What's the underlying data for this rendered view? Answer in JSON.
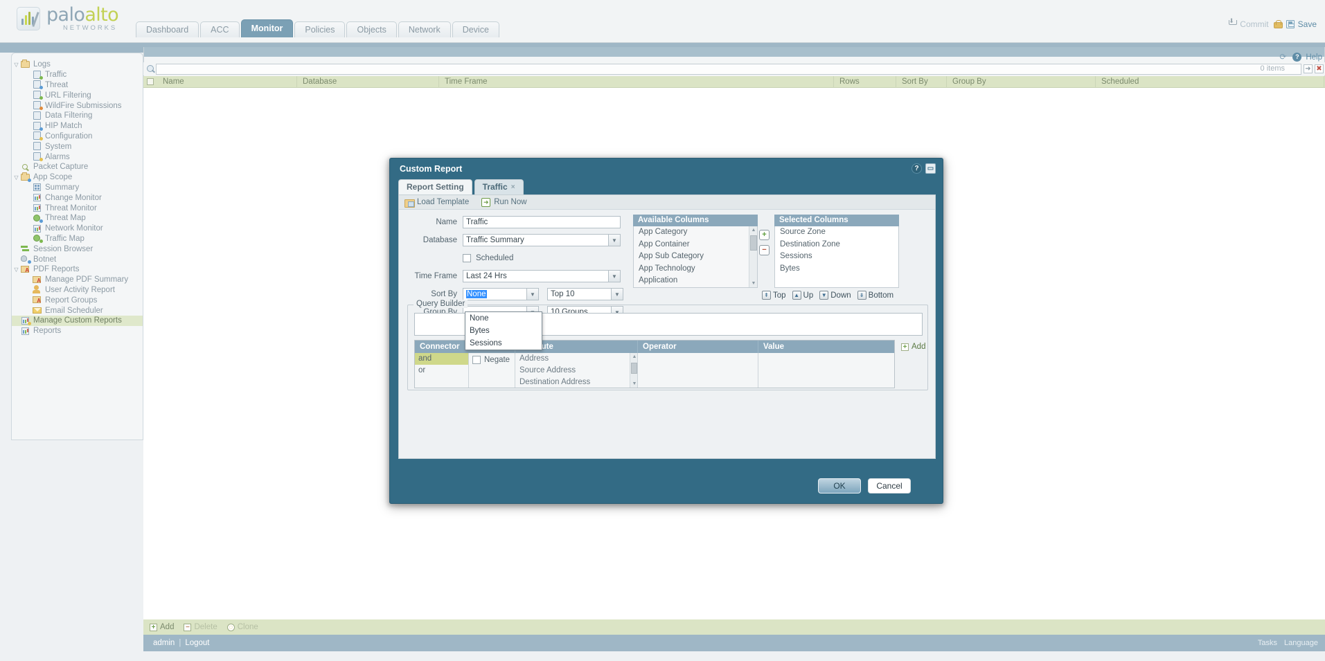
{
  "brand": {
    "name_part1": "palo",
    "name_part2": "alto",
    "subtitle": "NETWORKS"
  },
  "nav": {
    "tabs": [
      {
        "label": "Dashboard",
        "active": false
      },
      {
        "label": "ACC",
        "active": false
      },
      {
        "label": "Monitor",
        "active": true
      },
      {
        "label": "Policies",
        "active": false
      },
      {
        "label": "Objects",
        "active": false
      },
      {
        "label": "Network",
        "active": false
      },
      {
        "label": "Device",
        "active": false
      }
    ],
    "commit_label": "Commit",
    "save_label": "Save",
    "help_label": "Help"
  },
  "sidebar": {
    "items": [
      {
        "label": "Logs",
        "level": 1,
        "twisty": "▽",
        "icon": "logs-folder-icon",
        "selected": false
      },
      {
        "label": "Traffic",
        "level": 2,
        "twisty": "",
        "icon": "traffic-log-icon",
        "selected": false
      },
      {
        "label": "Threat",
        "level": 2,
        "twisty": "",
        "icon": "threat-log-icon",
        "selected": false
      },
      {
        "label": "URL Filtering",
        "level": 2,
        "twisty": "",
        "icon": "url-filtering-icon",
        "selected": false
      },
      {
        "label": "WildFire Submissions",
        "level": 2,
        "twisty": "",
        "icon": "wildfire-icon",
        "selected": false
      },
      {
        "label": "Data Filtering",
        "level": 2,
        "twisty": "",
        "icon": "data-filtering-icon",
        "selected": false
      },
      {
        "label": "HIP Match",
        "level": 2,
        "twisty": "",
        "icon": "hip-match-icon",
        "selected": false
      },
      {
        "label": "Configuration",
        "level": 2,
        "twisty": "",
        "icon": "configuration-icon",
        "selected": false
      },
      {
        "label": "System",
        "level": 2,
        "twisty": "",
        "icon": "system-icon",
        "selected": false
      },
      {
        "label": "Alarms",
        "level": 2,
        "twisty": "",
        "icon": "alarms-icon",
        "selected": false
      },
      {
        "label": "Packet Capture",
        "level": 1,
        "twisty": "",
        "icon": "packet-capture-icon",
        "selected": false
      },
      {
        "label": "App Scope",
        "level": 1,
        "twisty": "▽",
        "icon": "app-scope-icon",
        "selected": false
      },
      {
        "label": "Summary",
        "level": 2,
        "twisty": "",
        "icon": "summary-icon",
        "selected": false
      },
      {
        "label": "Change Monitor",
        "level": 2,
        "twisty": "",
        "icon": "change-monitor-icon",
        "selected": false
      },
      {
        "label": "Threat Monitor",
        "level": 2,
        "twisty": "",
        "icon": "threat-monitor-icon",
        "selected": false
      },
      {
        "label": "Threat Map",
        "level": 2,
        "twisty": "",
        "icon": "threat-map-icon",
        "selected": false
      },
      {
        "label": "Network Monitor",
        "level": 2,
        "twisty": "",
        "icon": "network-monitor-icon",
        "selected": false
      },
      {
        "label": "Traffic Map",
        "level": 2,
        "twisty": "",
        "icon": "traffic-map-icon",
        "selected": false
      },
      {
        "label": "Session Browser",
        "level": 1,
        "twisty": "",
        "icon": "session-browser-icon",
        "selected": false
      },
      {
        "label": "Botnet",
        "level": 1,
        "twisty": "",
        "icon": "botnet-icon",
        "selected": false
      },
      {
        "label": "PDF Reports",
        "level": 1,
        "twisty": "▽",
        "icon": "pdf-reports-icon",
        "selected": false
      },
      {
        "label": "Manage PDF Summary",
        "level": 2,
        "twisty": "",
        "icon": "manage-pdf-summary-icon",
        "selected": false
      },
      {
        "label": "User Activity Report",
        "level": 2,
        "twisty": "",
        "icon": "user-activity-icon",
        "selected": false
      },
      {
        "label": "Report Groups",
        "level": 2,
        "twisty": "",
        "icon": "report-groups-icon",
        "selected": false
      },
      {
        "label": "Email Scheduler",
        "level": 2,
        "twisty": "",
        "icon": "email-scheduler-icon",
        "selected": false
      },
      {
        "label": "Manage Custom Reports",
        "level": 1,
        "twisty": "",
        "icon": "manage-custom-reports-icon",
        "selected": true
      },
      {
        "label": "Reports",
        "level": 1,
        "twisty": "",
        "icon": "reports-icon",
        "selected": false
      }
    ]
  },
  "search": {
    "value": "",
    "placeholder": "",
    "items_count": "0 items"
  },
  "grid": {
    "columns": [
      "Name",
      "Database",
      "Time Frame",
      "Rows",
      "Sort By",
      "Group By",
      "Scheduled"
    ],
    "rows": []
  },
  "footer": {
    "add_label": "Add",
    "delete_label": "Delete",
    "clone_label": "Clone"
  },
  "statusbar": {
    "user": "admin",
    "separator": "|",
    "logout": "Logout",
    "tasks": "Tasks",
    "language": "Language"
  },
  "modal": {
    "title": "Custom Report",
    "tabs": [
      {
        "label": "Report Setting",
        "active": true,
        "closable": false
      },
      {
        "label": "Traffic",
        "active": false,
        "closable": true,
        "close_glyph": "×"
      }
    ],
    "actions": {
      "load_template": "Load Template",
      "run_now": "Run Now"
    },
    "form": {
      "name_label": "Name",
      "name_value": "Traffic",
      "database_label": "Database",
      "database_value": "Traffic Summary",
      "scheduled_label": "Scheduled",
      "scheduled_checked": false,
      "timeframe_label": "Time Frame",
      "timeframe_value": "Last 24 Hrs",
      "sortby_label": "Sort By",
      "sortby_value": "None",
      "sortby_top_value": "Top 10",
      "groupby_label": "Group By",
      "groupby_groups_value": "10 Groups"
    },
    "sortby_dropdown": {
      "open": true,
      "options": [
        "None",
        "Bytes",
        "Sessions"
      ]
    },
    "available_columns": {
      "header": "Available Columns",
      "items": [
        "App Category",
        "App Container",
        "App Sub Category",
        "App Technology",
        "Application"
      ]
    },
    "selected_columns": {
      "header": "Selected Columns",
      "items": [
        "Source Zone",
        "Destination Zone",
        "Sessions",
        "Bytes"
      ]
    },
    "transfer_buttons": {
      "add": "+",
      "remove": "−"
    },
    "move_buttons": [
      {
        "label": "Top",
        "glyph": "⇞"
      },
      {
        "label": "Up",
        "glyph": "▲"
      },
      {
        "label": "Down",
        "glyph": "▼"
      },
      {
        "label": "Bottom",
        "glyph": "⇟"
      }
    ],
    "query_builder": {
      "legend": "Query Builder",
      "query_value": "",
      "columns": [
        "Connector",
        "Attribute",
        "Operator",
        "Value"
      ],
      "connector_options": [
        "and",
        "or"
      ],
      "connector_selected": "and",
      "negate_label": "Negate",
      "negate_checked": false,
      "attribute_options": [
        "Address",
        "Source Address",
        "Destination Address"
      ],
      "operator_value": "",
      "value_value": "",
      "add_label": "Add"
    },
    "buttons": {
      "ok": "OK",
      "cancel": "Cancel"
    }
  }
}
